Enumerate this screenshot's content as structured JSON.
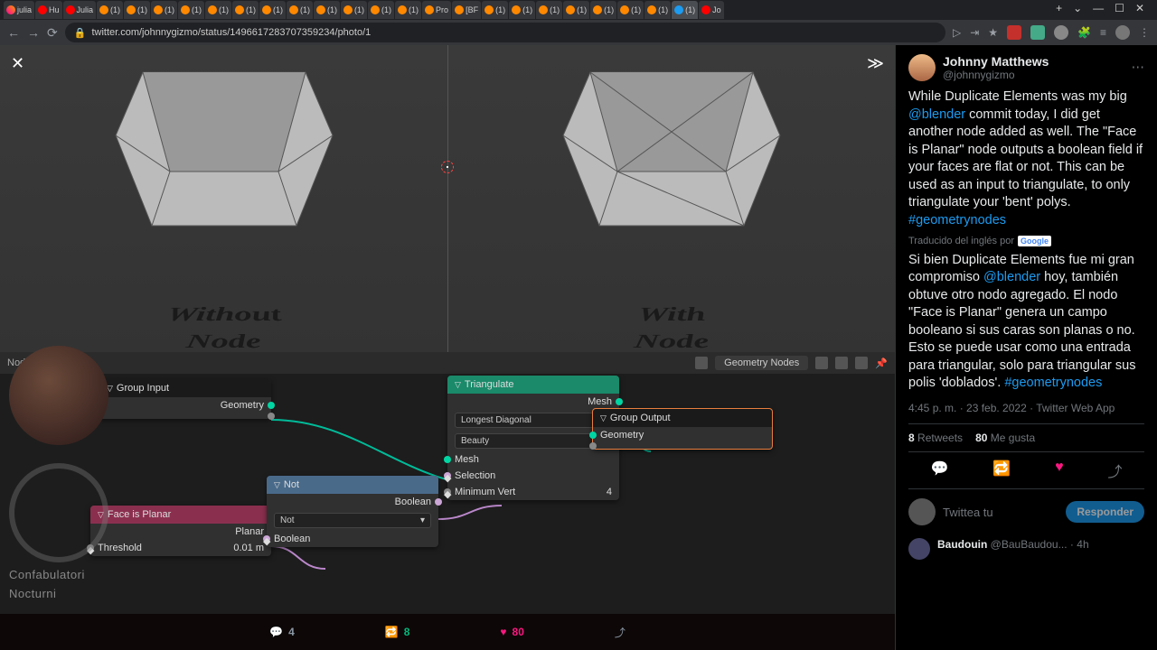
{
  "browser": {
    "tabs": [
      {
        "label": "julia",
        "type": "ig"
      },
      {
        "label": "Hu",
        "type": "yt"
      },
      {
        "label": "Julia",
        "type": "yt"
      },
      {
        "label": "(1)",
        "type": "bl"
      },
      {
        "label": "(1)",
        "type": "bl"
      },
      {
        "label": "(1)",
        "type": "bl"
      },
      {
        "label": "(1)",
        "type": "bl"
      },
      {
        "label": "(1)",
        "type": "bl"
      },
      {
        "label": "(1)",
        "type": "bl"
      },
      {
        "label": "(1)",
        "type": "bl"
      },
      {
        "label": "(1)",
        "type": "bl"
      },
      {
        "label": "(1)",
        "type": "bl"
      },
      {
        "label": "(1)",
        "type": "bl"
      },
      {
        "label": "(1)",
        "type": "bl"
      },
      {
        "label": "(1)",
        "type": "bl"
      },
      {
        "label": "Pro",
        "type": "bl"
      },
      {
        "label": "[BF",
        "type": "bl"
      },
      {
        "label": "(1)",
        "type": "bl"
      },
      {
        "label": "(1)",
        "type": "bl"
      },
      {
        "label": "(1)",
        "type": "bl"
      },
      {
        "label": "(1)",
        "type": "bl"
      },
      {
        "label": "(1)",
        "type": "bl"
      },
      {
        "label": "(1)",
        "type": "bl"
      },
      {
        "label": "(1)",
        "type": "bl"
      },
      {
        "label": "(1)",
        "type": "tw",
        "active": true
      },
      {
        "label": "Jo",
        "type": "yt"
      }
    ],
    "url": "twitter.com/johnnygizmo/status/1496617283707359234/photo/1"
  },
  "viewport": {
    "left_label_1": "Without",
    "left_label_2": "Node",
    "right_label_1": "With",
    "right_label_2": "Node"
  },
  "node_editor": {
    "header_label": "Node",
    "tree_name": "Geometry Nodes",
    "group_input": {
      "title": "Group Input",
      "out1": "Geometry"
    },
    "face_planar": {
      "title": "Face is Planar",
      "out1": "Planar",
      "in1": "Threshold",
      "in1_val": "0.01 m"
    },
    "not_node": {
      "title": "Not",
      "out1": "Boolean",
      "dropdown": "Not",
      "in1": "Boolean"
    },
    "triangulate": {
      "title": "Triangulate",
      "out1": "Mesh",
      "dd1": "Longest Diagonal",
      "dd2": "Beauty",
      "in1": "Mesh",
      "in2": "Selection",
      "in3": "Minimum Vert",
      "in3_val": "4"
    },
    "group_output": {
      "title": "Group Output",
      "in1": "Geometry"
    }
  },
  "media_actions": {
    "replies": "4",
    "retweets": "8",
    "likes": "80"
  },
  "presenter": {
    "watermark1": "Confabulatori",
    "watermark2": "Nocturni"
  },
  "tweet": {
    "name": "Johnny Matthews",
    "handle": "@johnnygizmo",
    "body_pre": "While Duplicate Elements was my big ",
    "mention": "@blender",
    "body_mid": " commit today, I did get another node added as well. The \"Face is Planar\" node outputs a boolean field if your faces are flat or not. This can be used as an input to triangulate, to only triangulate your 'bent' polys. ",
    "hashtag": "#geometrynodes",
    "translated_label": "Traducido del inglés por",
    "translated_brand": "Google",
    "trans_pre": "Si bien Duplicate Elements fue mi gran compromiso ",
    "trans_mid": " hoy, también obtuve otro nodo agregado. El nodo \"Face is Planar\" genera un campo booleano si sus caras son planas o no. Esto se puede usar como una entrada para triangular, solo para triangular sus polis 'doblados'. ",
    "meta": "4:45 p. m. · 23 feb. 2022 · Twitter Web App",
    "stats_rt_count": "8",
    "stats_rt_label": "Retweets",
    "stats_like_count": "80",
    "stats_like_label": "Me gusta",
    "reply_placeholder": "Twittea tu",
    "reply_btn": "Responder",
    "reply_user_name": "Baudouin",
    "reply_user_handle": "@BauBaudou...",
    "reply_time": "4h"
  }
}
